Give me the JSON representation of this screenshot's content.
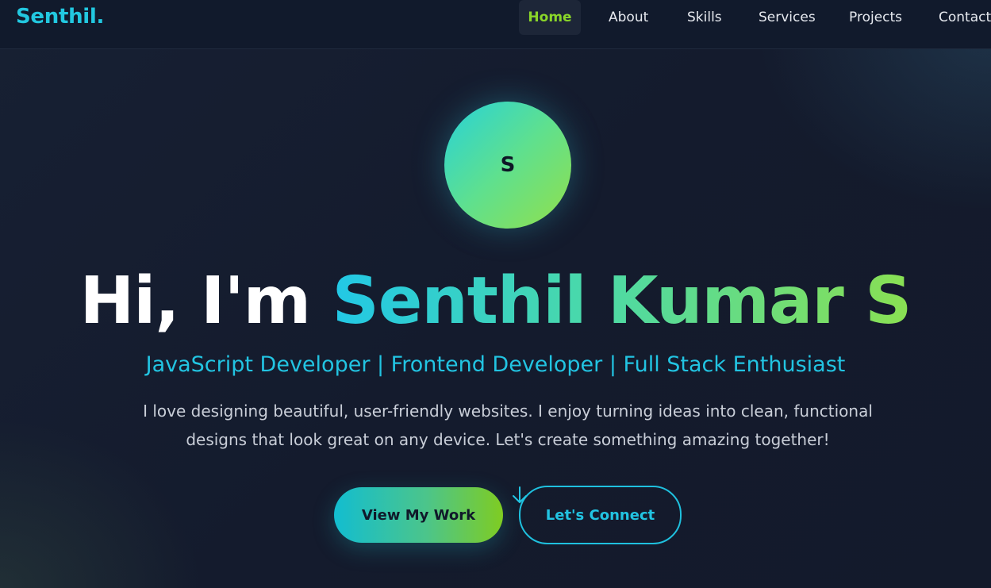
{
  "navbar": {
    "logo": "Senthil.",
    "links": [
      {
        "label": "Home",
        "active": true
      },
      {
        "label": "About"
      },
      {
        "label": "Skills"
      },
      {
        "label": "Services"
      },
      {
        "label": "Projects"
      },
      {
        "label": "Contact"
      }
    ]
  },
  "hero": {
    "avatar_letter": "S",
    "greeting": "Hi, I'm ",
    "name": "Senthil Kumar S",
    "subtitle": "JavaScript Developer | Frontend Developer | Full Stack Enthusiast",
    "bio": "I love designing beautiful, user-friendly websites. I enjoy turning ideas into clean, functional designs that look great on any device. Let's create something amazing together!",
    "primary_button": "View My Work",
    "secondary_button": "Let's Connect",
    "scroll_icon": "arrow-down-icon"
  },
  "colors": {
    "accent_cyan": "#22c8e0",
    "accent_green": "#8ad629",
    "background": "#141c2e"
  }
}
